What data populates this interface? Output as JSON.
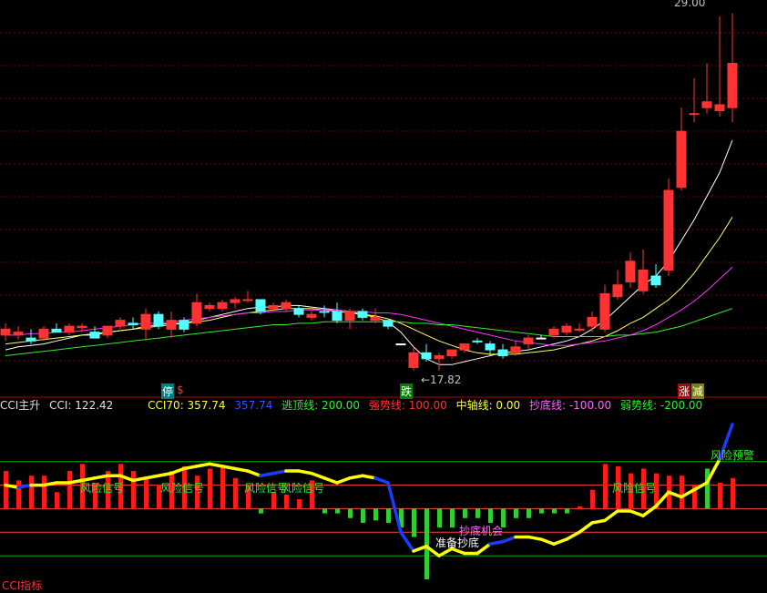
{
  "chart_data": [
    {
      "type": "candlestick",
      "x": [
        "1",
        "2",
        "3",
        "4",
        "5",
        "6",
        "7",
        "8",
        "9",
        "10",
        "11",
        "12",
        "13",
        "14",
        "15",
        "16",
        "17",
        "18",
        "19",
        "20",
        "21",
        "22",
        "23",
        "24",
        "25",
        "26",
        "27",
        "28",
        "29",
        "30",
        "31",
        "32",
        "33",
        "34",
        "35",
        "36",
        "37",
        "38",
        "39",
        "40",
        "41",
        "42",
        "43",
        "44",
        "45",
        "46",
        "47",
        "48",
        "49",
        "50",
        "51",
        "52",
        "53",
        "54",
        "55",
        "56",
        "57",
        "58"
      ],
      "candles": [
        {
          "o": 18.3,
          "h": 18.5,
          "l": 17.9,
          "c": 18.1,
          "color": "red"
        },
        {
          "o": 18.2,
          "h": 18.4,
          "l": 17.95,
          "c": 18.1,
          "color": "red"
        },
        {
          "o": 17.9,
          "h": 18.3,
          "l": 17.8,
          "c": 18.0,
          "color": "cyan"
        },
        {
          "o": 18.0,
          "h": 18.4,
          "l": 17.9,
          "c": 18.3,
          "color": "red"
        },
        {
          "o": 18.3,
          "h": 18.5,
          "l": 18.2,
          "c": 18.2,
          "color": "cyan"
        },
        {
          "o": 18.2,
          "h": 18.5,
          "l": 18.1,
          "c": 18.4,
          "color": "red"
        },
        {
          "o": 18.4,
          "h": 18.5,
          "l": 18.2,
          "c": 18.35,
          "color": "red"
        },
        {
          "o": 18.2,
          "h": 18.4,
          "l": 18.0,
          "c": 18.0,
          "color": "cyan"
        },
        {
          "o": 18.1,
          "h": 18.4,
          "l": 18.0,
          "c": 18.4,
          "color": "red"
        },
        {
          "o": 18.4,
          "h": 18.7,
          "l": 18.3,
          "c": 18.6,
          "color": "red"
        },
        {
          "o": 18.45,
          "h": 18.7,
          "l": 18.3,
          "c": 18.5,
          "color": "cyan"
        },
        {
          "o": 18.3,
          "h": 19.0,
          "l": 17.9,
          "c": 18.8,
          "color": "red"
        },
        {
          "o": 18.8,
          "h": 18.9,
          "l": 18.3,
          "c": 18.4,
          "color": "cyan"
        },
        {
          "o": 18.3,
          "h": 18.9,
          "l": 18.0,
          "c": 18.6,
          "color": "red"
        },
        {
          "o": 18.6,
          "h": 18.7,
          "l": 18.2,
          "c": 18.3,
          "color": "cyan"
        },
        {
          "o": 18.5,
          "h": 19.5,
          "l": 18.4,
          "c": 19.2,
          "color": "red"
        },
        {
          "o": 19.0,
          "h": 19.2,
          "l": 18.9,
          "c": 19.1,
          "color": "red"
        },
        {
          "o": 19.0,
          "h": 19.3,
          "l": 18.9,
          "c": 19.2,
          "color": "red"
        },
        {
          "o": 19.2,
          "h": 19.4,
          "l": 19.0,
          "c": 19.3,
          "color": "red"
        },
        {
          "o": 19.3,
          "h": 19.6,
          "l": 19.2,
          "c": 19.3,
          "color": "red"
        },
        {
          "o": 19.3,
          "h": 19.3,
          "l": 18.8,
          "c": 18.9,
          "color": "cyan"
        },
        {
          "o": 19.0,
          "h": 19.2,
          "l": 18.9,
          "c": 19.1,
          "color": "red"
        },
        {
          "o": 19.0,
          "h": 19.3,
          "l": 18.9,
          "c": 19.2,
          "color": "red"
        },
        {
          "o": 19.0,
          "h": 19.1,
          "l": 18.7,
          "c": 18.8,
          "color": "cyan"
        },
        {
          "o": 18.7,
          "h": 19.0,
          "l": 18.6,
          "c": 18.8,
          "color": "red"
        },
        {
          "o": 18.9,
          "h": 19.1,
          "l": 18.7,
          "c": 18.9,
          "color": "cyan"
        },
        {
          "o": 18.9,
          "h": 19.2,
          "l": 18.5,
          "c": 18.6,
          "color": "cyan"
        },
        {
          "o": 18.6,
          "h": 19.0,
          "l": 18.3,
          "c": 18.9,
          "color": "red"
        },
        {
          "o": 18.9,
          "h": 19.0,
          "l": 18.6,
          "c": 18.7,
          "color": "cyan"
        },
        {
          "o": 18.7,
          "h": 19.0,
          "l": 18.5,
          "c": 18.6,
          "color": "red"
        },
        {
          "o": 18.6,
          "h": 18.6,
          "l": 18.3,
          "c": 18.4,
          "color": "cyan"
        },
        {
          "o": 17.8,
          "h": 17.8,
          "l": 17.8,
          "c": 17.8,
          "color": "white"
        },
        {
          "o": 17.5,
          "h": 17.7,
          "l": 16.9,
          "c": 17.0,
          "color": "red"
        },
        {
          "o": 17.3,
          "h": 17.8,
          "l": 17.2,
          "c": 17.5,
          "color": "cyan"
        },
        {
          "o": 17.3,
          "h": 17.5,
          "l": 16.9,
          "c": 17.4,
          "color": "red"
        },
        {
          "o": 17.4,
          "h": 17.6,
          "l": 17.3,
          "c": 17.6,
          "color": "red"
        },
        {
          "o": 17.6,
          "h": 17.8,
          "l": 17.5,
          "c": 17.8,
          "color": "red"
        },
        {
          "o": 17.9,
          "h": 18.0,
          "l": 17.8,
          "c": 17.9,
          "color": "cyan"
        },
        {
          "o": 17.8,
          "h": 17.9,
          "l": 17.4,
          "c": 17.6,
          "color": "cyan"
        },
        {
          "o": 17.6,
          "h": 17.8,
          "l": 17.3,
          "c": 17.4,
          "color": "cyan"
        },
        {
          "o": 17.5,
          "h": 17.9,
          "l": 17.4,
          "c": 17.7,
          "color": "red"
        },
        {
          "o": 17.8,
          "h": 18.1,
          "l": 17.6,
          "c": 18.0,
          "color": "red"
        },
        {
          "o": 18.0,
          "h": 18.1,
          "l": 18.0,
          "c": 18.0,
          "color": "white"
        },
        {
          "o": 18.1,
          "h": 18.4,
          "l": 18.0,
          "c": 18.3,
          "color": "red"
        },
        {
          "o": 18.4,
          "h": 18.5,
          "l": 18.1,
          "c": 18.2,
          "color": "red"
        },
        {
          "o": 18.3,
          "h": 18.5,
          "l": 18.2,
          "c": 18.3,
          "color": "red"
        },
        {
          "o": 18.4,
          "h": 18.9,
          "l": 18.2,
          "c": 18.7,
          "color": "red"
        },
        {
          "o": 18.3,
          "h": 19.8,
          "l": 18.2,
          "c": 19.5,
          "color": "red"
        },
        {
          "o": 19.4,
          "h": 20.3,
          "l": 19.3,
          "c": 19.8,
          "color": "red"
        },
        {
          "o": 19.9,
          "h": 20.9,
          "l": 19.7,
          "c": 20.6,
          "color": "red"
        },
        {
          "o": 19.6,
          "h": 21.0,
          "l": 19.5,
          "c": 20.3,
          "color": "red"
        },
        {
          "o": 19.8,
          "h": 20.5,
          "l": 19.7,
          "c": 20.1,
          "color": "cyan"
        },
        {
          "o": 20.3,
          "h": 23.4,
          "l": 20.1,
          "c": 23.0,
          "color": "red"
        },
        {
          "o": 23.1,
          "h": 25.8,
          "l": 23.0,
          "c": 25.0,
          "color": "red"
        },
        {
          "o": 25.6,
          "h": 26.8,
          "l": 25.3,
          "c": 25.6,
          "color": "red"
        },
        {
          "o": 25.8,
          "h": 27.3,
          "l": 25.6,
          "c": 26.0,
          "color": "red"
        },
        {
          "o": 25.7,
          "h": 28.9,
          "l": 25.5,
          "c": 25.9,
          "color": "red"
        },
        {
          "o": 25.8,
          "h": 29.0,
          "l": 25.3,
          "c": 27.3,
          "color": "red"
        }
      ],
      "ma_lines": [
        {
          "name": "ma-white",
          "color": "#ffffff",
          "values": [
            17.6,
            17.7,
            17.75,
            17.8,
            17.9,
            18.0,
            18.1,
            18.1,
            18.2,
            18.25,
            18.3,
            18.4,
            18.45,
            18.5,
            18.5,
            18.6,
            18.7,
            18.8,
            18.9,
            19.0,
            19.05,
            19.05,
            19.1,
            19.1,
            19.05,
            19.0,
            18.95,
            18.9,
            18.8,
            18.7,
            18.55,
            18.2,
            17.7,
            17.3,
            17.1,
            17.1,
            17.2,
            17.3,
            17.4,
            17.5,
            17.55,
            17.6,
            17.7,
            17.8,
            17.9,
            18.05,
            18.3,
            18.6,
            19.0,
            19.4,
            19.8,
            20.1,
            20.6,
            21.3,
            22.0,
            22.8,
            23.6,
            24.7
          ]
        },
        {
          "name": "ma-yellow",
          "color": "#ffff66",
          "values": [
            17.8,
            17.85,
            17.9,
            17.95,
            18.0,
            18.05,
            18.1,
            18.15,
            18.2,
            18.25,
            18.3,
            18.35,
            18.4,
            18.45,
            18.5,
            18.55,
            18.6,
            18.7,
            18.8,
            18.85,
            18.9,
            18.95,
            19.0,
            19.0,
            19.0,
            18.95,
            18.9,
            18.85,
            18.8,
            18.75,
            18.65,
            18.5,
            18.3,
            18.1,
            17.9,
            17.75,
            17.6,
            17.5,
            17.45,
            17.45,
            17.45,
            17.5,
            17.55,
            17.6,
            17.7,
            17.8,
            17.9,
            18.05,
            18.25,
            18.5,
            18.7,
            19.0,
            19.3,
            19.7,
            20.2,
            20.8,
            21.4,
            22.1
          ]
        },
        {
          "name": "ma-magenta",
          "color": "#ff33ff",
          "values": [
            18.1,
            18.1,
            18.15,
            18.15,
            18.2,
            18.2,
            18.25,
            18.3,
            18.35,
            18.4,
            18.45,
            18.5,
            18.5,
            18.55,
            18.6,
            18.65,
            18.7,
            18.75,
            18.8,
            18.85,
            18.85,
            18.9,
            18.9,
            18.95,
            18.95,
            18.95,
            18.95,
            18.9,
            18.9,
            18.85,
            18.85,
            18.8,
            18.7,
            18.6,
            18.5,
            18.4,
            18.3,
            18.2,
            18.1,
            18.0,
            17.9,
            17.85,
            17.8,
            17.75,
            17.75,
            17.8,
            17.85,
            17.9,
            18.0,
            18.1,
            18.25,
            18.45,
            18.7,
            18.95,
            19.25,
            19.6,
            20.0,
            20.4
          ]
        },
        {
          "name": "ma-green",
          "color": "#33ee33",
          "values": [
            17.4,
            17.45,
            17.5,
            17.55,
            17.6,
            17.65,
            17.7,
            17.75,
            17.8,
            17.85,
            17.9,
            17.95,
            18.0,
            18.05,
            18.1,
            18.15,
            18.2,
            18.25,
            18.3,
            18.35,
            18.4,
            18.45,
            18.45,
            18.5,
            18.5,
            18.55,
            18.55,
            18.55,
            18.55,
            18.55,
            18.55,
            18.55,
            18.5,
            18.5,
            18.45,
            18.45,
            18.4,
            18.35,
            18.3,
            18.25,
            18.2,
            18.15,
            18.1,
            18.05,
            18.05,
            18.05,
            18.05,
            18.05,
            18.1,
            18.1,
            18.15,
            18.2,
            18.3,
            18.4,
            18.55,
            18.7,
            18.85,
            19.0
          ]
        }
      ],
      "annotations": {
        "high_label": "29.00",
        "low_label": "17.82"
      }
    },
    {
      "type": "bar+line",
      "title": "CCI主升",
      "x": [
        "1",
        "2",
        "3",
        "4",
        "5",
        "6",
        "7",
        "8",
        "9",
        "10",
        "11",
        "12",
        "13",
        "14",
        "15",
        "16",
        "17",
        "18",
        "19",
        "20",
        "21",
        "22",
        "23",
        "24",
        "25",
        "26",
        "27",
        "28",
        "29",
        "30",
        "31",
        "32",
        "33",
        "34",
        "35",
        "36",
        "37",
        "38",
        "39",
        "40",
        "41",
        "42",
        "43",
        "44",
        "45",
        "46",
        "47",
        "48",
        "49",
        "50",
        "51",
        "52",
        "53",
        "54",
        "55",
        "56",
        "57",
        "58"
      ],
      "bars": [
        160,
        120,
        140,
        140,
        70,
        160,
        190,
        110,
        160,
        190,
        160,
        130,
        100,
        160,
        180,
        140,
        170,
        180,
        130,
        100,
        -20,
        70,
        60,
        40,
        120,
        -20,
        -20,
        -40,
        -60,
        -50,
        -60,
        -80,
        -120,
        -300,
        -80,
        -80,
        -40,
        -40,
        -60,
        -80,
        -40,
        -40,
        -20,
        -20,
        -20,
        10,
        80,
        190,
        180,
        150,
        170,
        150,
        140,
        140,
        100,
        170,
        110,
        130
      ],
      "bar_colors": [
        "red",
        "red",
        "red",
        "red",
        "red",
        "red",
        "red",
        "red",
        "red",
        "red",
        "red",
        "red",
        "red",
        "red",
        "red",
        "red",
        "red",
        "red",
        "red",
        "red",
        "green",
        "red",
        "red",
        "red",
        "red",
        "green",
        "green",
        "green",
        "green",
        "green",
        "green",
        "green",
        "green",
        "green",
        "green",
        "green",
        "green",
        "green",
        "green",
        "green",
        "green",
        "green",
        "green",
        "green",
        "green",
        "red",
        "red",
        "red",
        "red",
        "red",
        "red",
        "red",
        "red",
        "red",
        "red",
        "green",
        "red",
        "red"
      ],
      "cci": [
        100,
        90,
        100,
        100,
        110,
        110,
        120,
        130,
        140,
        140,
        120,
        130,
        140,
        150,
        170,
        180,
        190,
        180,
        170,
        160,
        140,
        150,
        160,
        160,
        150,
        130,
        110,
        130,
        140,
        130,
        110,
        -100,
        -180,
        -160,
        -200,
        -170,
        -190,
        -190,
        -150,
        -140,
        -120,
        -120,
        -130,
        -150,
        -130,
        -100,
        -60,
        -50,
        -10,
        -10,
        -30,
        10,
        70,
        50,
        80,
        110,
        210,
        357.74
      ],
      "cci_colors": [
        "yellow",
        "yellow",
        "blue",
        "yellow",
        "yellow",
        "yellow",
        "yellow",
        "yellow",
        "yellow",
        "yellow",
        "yellow",
        "yellow",
        "yellow",
        "yellow",
        "yellow",
        "yellow",
        "yellow",
        "yellow",
        "yellow",
        "yellow",
        "yellow",
        "blue",
        "blue",
        "yellow",
        "yellow",
        "yellow",
        "yellow",
        "yellow",
        "yellow",
        "yellow",
        "blue",
        "blue",
        "blue",
        "yellow",
        "yellow",
        "yellow",
        "yellow",
        "yellow",
        "yellow",
        "blue",
        "blue",
        "yellow",
        "yellow",
        "yellow",
        "yellow",
        "yellow",
        "yellow",
        "yellow",
        "yellow",
        "yellow",
        "yellow",
        "yellow",
        "yellow",
        "yellow",
        "yellow",
        "yellow",
        "yellow",
        "blue"
      ],
      "lines": {
        "escape_top": 200,
        "strong": 100,
        "axis": 0,
        "bottom": -100,
        "weak": -200
      },
      "ylim": [
        -300,
        400
      ]
    }
  ],
  "main": {
    "marks": [
      {
        "text": "停",
        "bg": "#008080",
        "color": "#ffffff"
      },
      {
        "text": "$",
        "bg": "",
        "color": "#ff3333"
      },
      {
        "text": "跌",
        "bg": "#008000",
        "color": "#ffffff"
      },
      {
        "text": "涨",
        "bg": "#b30000",
        "color": "#ffffff"
      },
      {
        "text": "减",
        "bg": "#808000",
        "color": "#ffffff"
      }
    ],
    "high_label": "29.00",
    "low_label": "←17.82"
  },
  "info": {
    "name": "CCI主升",
    "cci_label": "CCI: 122.42",
    "cci70_label": "CCI70: 357.74",
    "blue_value": "357.74",
    "escape_top": "逃顶线: 200.00",
    "strong": "强势线: 100.00",
    "axis": "中轴线: 0.00",
    "bottom": "抄底线: -100.00",
    "weak": "弱势线: -200.00"
  },
  "signals": {
    "risk": "风险信号",
    "risk_warning": "风险预警",
    "prepare_bottom": "准备抄底",
    "bottom_chance": "抄底机会",
    "indicator": "CCI指标"
  },
  "colors": {
    "up": "#ff3333",
    "down": "#54ffff",
    "yellow": "#ffff00",
    "blue": "#1a3cff",
    "green": "#00cc00",
    "grid": "#800000",
    "hline_red": "#ff4040",
    "hline_green": "#00b000"
  }
}
